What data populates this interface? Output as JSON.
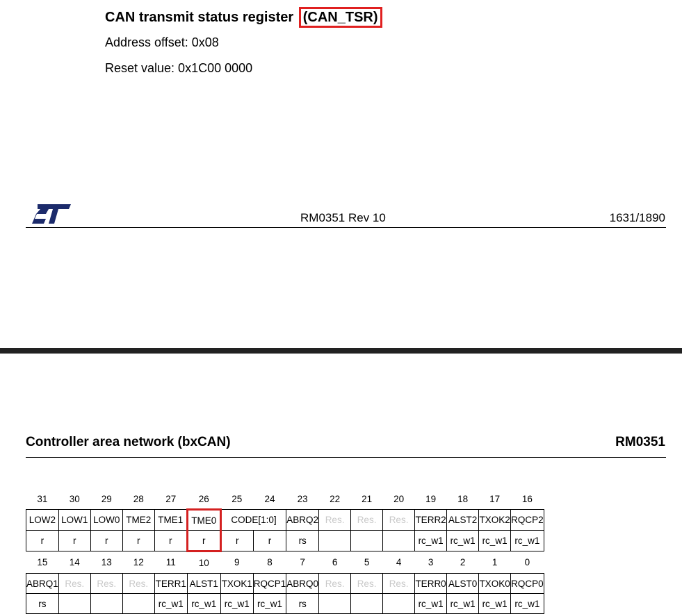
{
  "register": {
    "title_prefix": "CAN transmit status register ",
    "title_abbrev": "(CAN_TSR)",
    "address_offset": "Address offset: 0x08",
    "reset_value": "Reset value: 0x1C00 0000"
  },
  "footer": {
    "logo_text": "ST",
    "document": "RM0351 Rev 10",
    "page": "1631/1890"
  },
  "header": {
    "section": "Controller area network (bxCAN)",
    "document": "RM0351"
  },
  "colors": {
    "highlight": "#e02020",
    "reserved_text": "#c8c8c8"
  },
  "table": {
    "upper": {
      "bits": [
        "31",
        "30",
        "29",
        "28",
        "27",
        "26",
        "25",
        "24",
        "23",
        "22",
        "21",
        "20",
        "19",
        "18",
        "17",
        "16"
      ],
      "fields": [
        {
          "name": "LOW2",
          "span": 1,
          "access": [
            "r"
          ]
        },
        {
          "name": "LOW1",
          "span": 1,
          "access": [
            "r"
          ]
        },
        {
          "name": "LOW0",
          "span": 1,
          "access": [
            "r"
          ]
        },
        {
          "name": "TME2",
          "span": 1,
          "access": [
            "r"
          ]
        },
        {
          "name": "TME1",
          "span": 1,
          "access": [
            "r"
          ]
        },
        {
          "name": "TME0",
          "span": 1,
          "access": [
            "r"
          ],
          "highlight": true
        },
        {
          "name": "CODE[1:0]",
          "span": 2,
          "access": [
            "r",
            "r"
          ]
        },
        {
          "name": "ABRQ2",
          "span": 1,
          "access": [
            "rs"
          ]
        },
        {
          "name": "Res.",
          "span": 1,
          "access": [
            ""
          ],
          "reserved": true
        },
        {
          "name": "Res.",
          "span": 1,
          "access": [
            ""
          ],
          "reserved": true
        },
        {
          "name": "Res.",
          "span": 1,
          "access": [
            ""
          ],
          "reserved": true
        },
        {
          "name": "TERR2",
          "span": 1,
          "access": [
            "rc_w1"
          ]
        },
        {
          "name": "ALST2",
          "span": 1,
          "access": [
            "rc_w1"
          ]
        },
        {
          "name": "TXOK2",
          "span": 1,
          "access": [
            "rc_w1"
          ]
        },
        {
          "name": "RQCP2",
          "span": 1,
          "access": [
            "rc_w1"
          ]
        }
      ]
    },
    "lower": {
      "bits": [
        "15",
        "14",
        "13",
        "12",
        "11",
        "10",
        "9",
        "8",
        "7",
        "6",
        "5",
        "4",
        "3",
        "2",
        "1",
        "0"
      ],
      "fields": [
        {
          "name": "ABRQ1",
          "span": 1,
          "access": [
            "rs"
          ]
        },
        {
          "name": "Res.",
          "span": 1,
          "access": [
            ""
          ],
          "reserved": true
        },
        {
          "name": "Res.",
          "span": 1,
          "access": [
            ""
          ],
          "reserved": true
        },
        {
          "name": "Res.",
          "span": 1,
          "access": [
            ""
          ],
          "reserved": true
        },
        {
          "name": "TERR1",
          "span": 1,
          "access": [
            "rc_w1"
          ]
        },
        {
          "name": "ALST1",
          "span": 1,
          "access": [
            "rc_w1"
          ]
        },
        {
          "name": "TXOK1",
          "span": 1,
          "access": [
            "rc_w1"
          ]
        },
        {
          "name": "RQCP1",
          "span": 1,
          "access": [
            "rc_w1"
          ]
        },
        {
          "name": "ABRQ0",
          "span": 1,
          "access": [
            "rs"
          ]
        },
        {
          "name": "Res.",
          "span": 1,
          "access": [
            ""
          ],
          "reserved": true
        },
        {
          "name": "Res.",
          "span": 1,
          "access": [
            ""
          ],
          "reserved": true
        },
        {
          "name": "Res.",
          "span": 1,
          "access": [
            ""
          ],
          "reserved": true
        },
        {
          "name": "TERR0",
          "span": 1,
          "access": [
            "rc_w1"
          ]
        },
        {
          "name": "ALST0",
          "span": 1,
          "access": [
            "rc_w1"
          ]
        },
        {
          "name": "TXOK0",
          "span": 1,
          "access": [
            "rc_w1"
          ]
        },
        {
          "name": "RQCP0",
          "span": 1,
          "access": [
            "rc_w1"
          ]
        }
      ]
    }
  }
}
